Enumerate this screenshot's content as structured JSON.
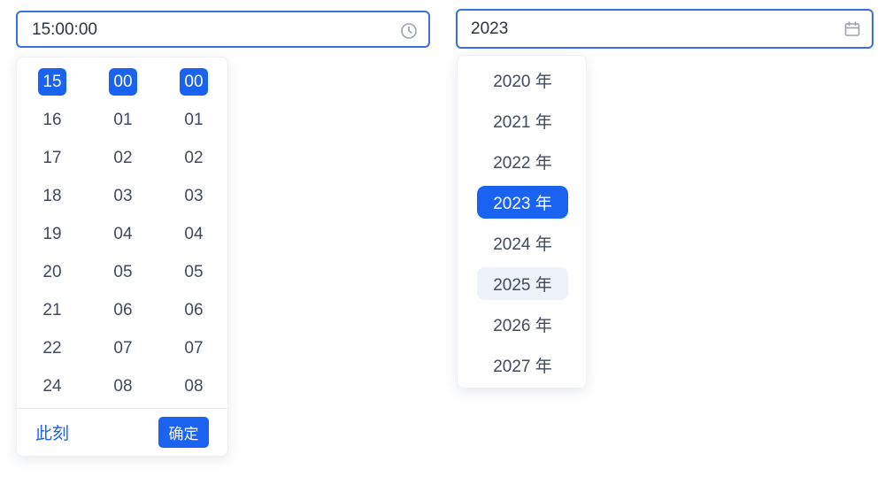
{
  "time_picker": {
    "value": "15:00:00",
    "icon": "clock-icon",
    "columns": [
      {
        "name": "hours",
        "selected": 0,
        "items": [
          "15",
          "16",
          "17",
          "18",
          "19",
          "20",
          "21",
          "22",
          "24"
        ]
      },
      {
        "name": "minutes",
        "selected": 0,
        "items": [
          "00",
          "01",
          "02",
          "03",
          "04",
          "05",
          "06",
          "07",
          "08"
        ]
      },
      {
        "name": "seconds",
        "selected": 0,
        "items": [
          "00",
          "01",
          "02",
          "03",
          "04",
          "05",
          "06",
          "07",
          "08"
        ]
      }
    ],
    "now_label": "此刻",
    "ok_label": "确定"
  },
  "year_picker": {
    "value": "2023",
    "icon": "calendar-icon",
    "selected": "2023 年",
    "hovered": "2025 年",
    "years": [
      "2020 年",
      "2021 年",
      "2022 年",
      "2023 年",
      "2024 年",
      "2025 年",
      "2026 年",
      "2027 年"
    ]
  },
  "colors": {
    "accent": "#1a62f0",
    "input_border": "#3a6fe0",
    "text": "#3f4a5e",
    "hover_bg": "#eef2f9"
  }
}
